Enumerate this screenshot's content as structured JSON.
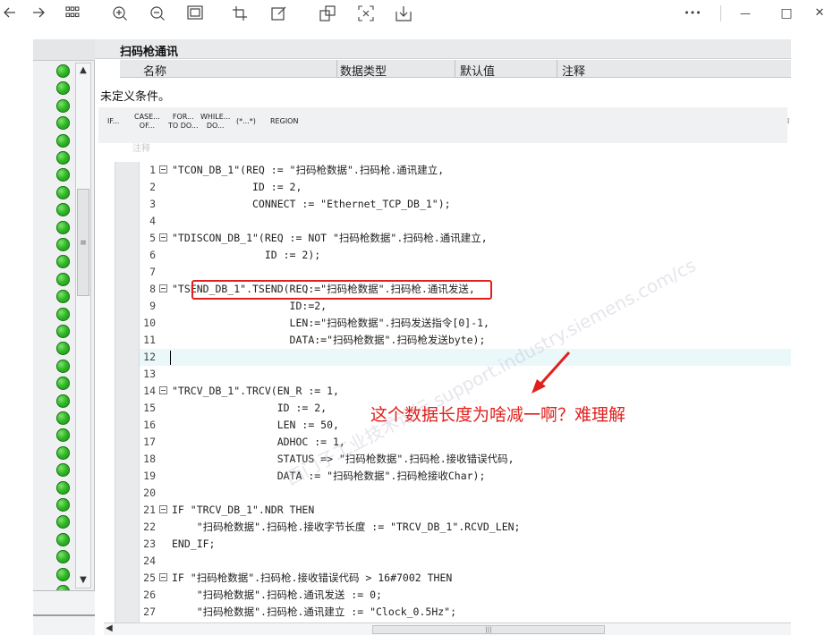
{
  "toolbar": {
    "back_icon": "arrow-left",
    "forward_icon": "arrow-right",
    "grid_icon": "grid",
    "zoom_in_icon": "zoom-in",
    "zoom_out_icon": "zoom-out",
    "fit_icon": "fit-screen",
    "crop_icon": "crop",
    "edit_icon": "edit",
    "extract_icon": "extract",
    "ocr_icon": "scan",
    "save_icon": "save",
    "more_label": "•••",
    "minimize_label": "—",
    "maximize_label": "□",
    "close_label": "✕"
  },
  "editor": {
    "block_title": "扫码枪通讯",
    "columns": [
      "名称",
      "数据类型",
      "默认值",
      "注释"
    ],
    "undefined_condition": "未定义条件。",
    "controls": [
      {
        "line1": "IF...",
        "line2": ""
      },
      {
        "line1": "CASE...",
        "line2": "OF..."
      },
      {
        "line1": "FOR...",
        "line2": "TO DO..."
      },
      {
        "line1": "WHILE...",
        "line2": "DO..."
      },
      {
        "line1": "(*...*)",
        "line2": ""
      },
      {
        "line1": "REGION",
        "line2": ""
      }
    ],
    "comment_label": "注释",
    "code_lines": [
      {
        "n": "1",
        "text": "\"TCON_DB_1\"(REQ := \"扫码枪数据\".扫码枪.通讯建立,",
        "fold": true
      },
      {
        "n": "2",
        "text": "             ID := 2,",
        "fold": false
      },
      {
        "n": "3",
        "text": "             CONNECT := \"Ethernet_TCP_DB_1\");",
        "fold": false
      },
      {
        "n": "4",
        "text": "",
        "fold": false
      },
      {
        "n": "5",
        "text": "\"TDISCON_DB_1\"(REQ := NOT \"扫码枪数据\".扫码枪.通讯建立,",
        "fold": true
      },
      {
        "n": "6",
        "text": "               ID := 2);",
        "fold": false
      },
      {
        "n": "7",
        "text": "",
        "fold": false
      },
      {
        "n": "8",
        "text": "\"TSEND_DB_1\".TSEND(REQ:=\"扫码枪数据\".扫码枪.通讯发送,",
        "fold": true
      },
      {
        "n": "9",
        "text": "                   ID:=2,",
        "fold": false
      },
      {
        "n": "10",
        "text": "                   LEN:=\"扫码枪数据\".扫码发送指令[0]-1,",
        "fold": false
      },
      {
        "n": "11",
        "text": "                   DATA:=\"扫码枪数据\".扫码枪发送byte);",
        "fold": false
      },
      {
        "n": "12",
        "text": "",
        "fold": false
      },
      {
        "n": "13",
        "text": "",
        "fold": false
      },
      {
        "n": "14",
        "text": "\"TRCV_DB_1\".TRCV(EN_R := 1,",
        "fold": true
      },
      {
        "n": "15",
        "text": "                 ID := 2,",
        "fold": false
      },
      {
        "n": "16",
        "text": "                 LEN := 50,",
        "fold": false
      },
      {
        "n": "17",
        "text": "                 ADHOC := 1,",
        "fold": false
      },
      {
        "n": "18",
        "text": "                 STATUS => \"扫码枪数据\".扫码枪.接收错误代码,",
        "fold": false
      },
      {
        "n": "19",
        "text": "                 DATA := \"扫码枪数据\".扫码枪接收Char);",
        "fold": false
      },
      {
        "n": "20",
        "text": "",
        "fold": false
      },
      {
        "n": "21",
        "text": "IF \"TRCV_DB_1\".NDR THEN",
        "fold": true
      },
      {
        "n": "22",
        "text": "    \"扫码枪数据\".扫码枪.接收字节长度 := \"TRCV_DB_1\".RCVD_LEN;",
        "fold": false
      },
      {
        "n": "23",
        "text": "END_IF;",
        "fold": false
      },
      {
        "n": "24",
        "text": "",
        "fold": false
      },
      {
        "n": "25",
        "text": "IF \"扫码枪数据\".扫码枪.接收错误代码 > 16#7002 THEN",
        "fold": true
      },
      {
        "n": "26",
        "text": "    \"扫码枪数据\".扫码枪.通讯发送 := 0;",
        "fold": false
      },
      {
        "n": "27",
        "text": "    \"扫码枪数据\".扫码枪.通讯建立 := \"Clock_0.5Hz\";",
        "fold": false
      }
    ]
  },
  "annotation": {
    "note": "这个数据长度为啥减一啊？难理解",
    "color": "#e0201c"
  },
  "watermark": "西门子工业技术论坛 support.industry.siemens.com/cs",
  "status": {
    "led_color": "#2fb525",
    "led_count": 32
  }
}
